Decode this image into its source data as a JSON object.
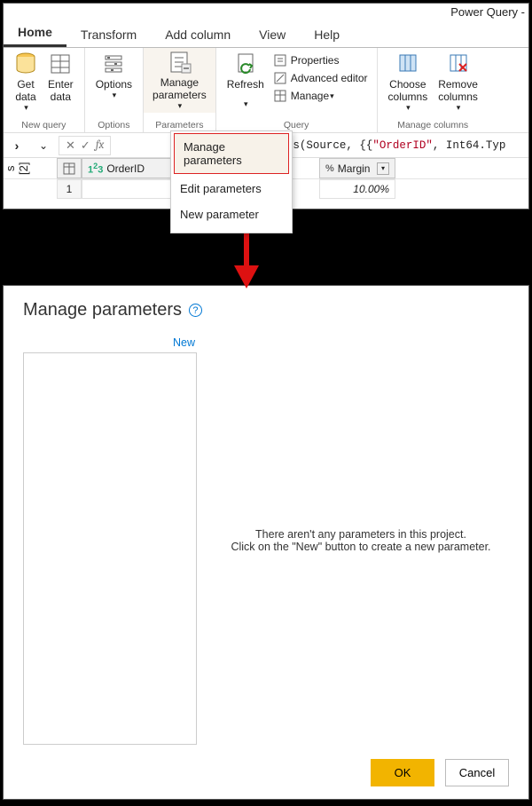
{
  "app_title": "Power Query -",
  "tabs": {
    "home": "Home",
    "transform": "Transform",
    "addcol": "Add column",
    "view": "View",
    "help": "Help"
  },
  "ribbon": {
    "newquery": {
      "getdata": "Get\ndata",
      "enterdata": "Enter\ndata",
      "title": "New query"
    },
    "options": {
      "label": "Options",
      "title": "Options"
    },
    "parameters": {
      "label": "Manage\nparameters",
      "title": "Parameters"
    },
    "query": {
      "refresh": "Refresh",
      "properties": "Properties",
      "adv": "Advanced editor",
      "manage": "Manage",
      "title": "Query"
    },
    "cols": {
      "choose": "Choose\ncolumns",
      "remove": "Remove\ncolumns",
      "title": "Manage columns"
    }
  },
  "dropdown": {
    "manage": "Manage parameters",
    "edit": "Edit parameters",
    "newp": "New parameter"
  },
  "side": {
    "count": "s [2]"
  },
  "formula": {
    "prefix": "mnTypes(Source, {{",
    "quoted": "\"OrderID\"",
    "suffix": ", Int64.Typ"
  },
  "columns": {
    "orderid": "OrderID",
    "margin": "Margin"
  },
  "rows": {
    "idx": "1",
    "marginval": "10.00%"
  },
  "dialog": {
    "title": "Manage parameters",
    "new": "New",
    "empty1": "There aren't any parameters in this project.",
    "empty2": "Click on the \"New\" button to create a new parameter.",
    "ok": "OK",
    "cancel": "Cancel"
  }
}
